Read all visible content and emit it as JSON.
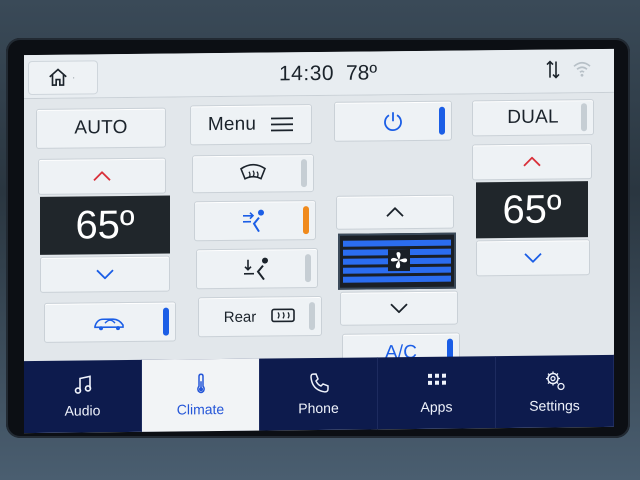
{
  "status": {
    "time": "14:30",
    "outside_temp": "78º"
  },
  "climate": {
    "auto_label": "AUTO",
    "menu_label": "Menu",
    "dual_label": "DUAL",
    "rear_label": "Rear",
    "ac_label": "A/C",
    "driver_temp": "65º",
    "passenger_temp": "65º",
    "fan_level": 0.7,
    "accent_color": "#1b5ee6",
    "active_mode_color": "#f08a1c"
  },
  "nav": {
    "items": [
      {
        "label": "Audio",
        "icon": "music-note-icon",
        "active": false
      },
      {
        "label": "Climate",
        "icon": "thermometer-icon",
        "active": true
      },
      {
        "label": "Phone",
        "icon": "phone-icon",
        "active": false
      },
      {
        "label": "Apps",
        "icon": "apps-grid-icon",
        "active": false
      },
      {
        "label": "Settings",
        "icon": "gear-icon",
        "active": false
      }
    ]
  }
}
